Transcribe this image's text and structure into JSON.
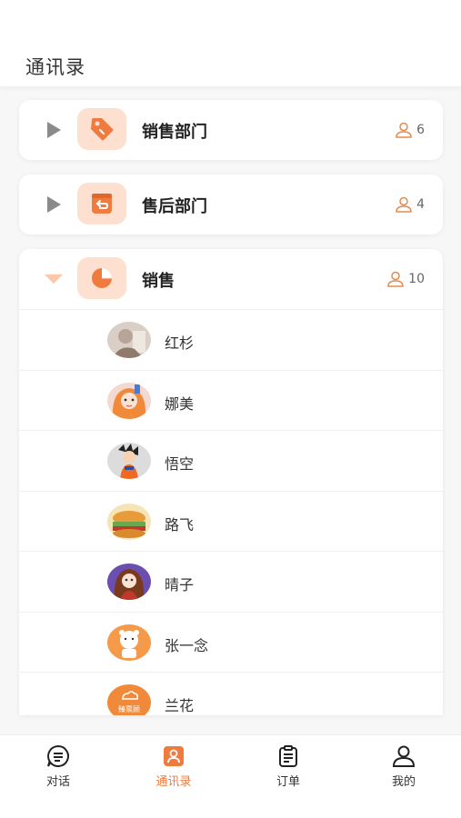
{
  "header": {
    "title": "通讯录"
  },
  "groups": [
    {
      "name": "销售部门",
      "count": "6",
      "expanded": false,
      "icon": "tag-icon"
    },
    {
      "name": "售后部门",
      "count": "4",
      "expanded": false,
      "icon": "return-box-icon"
    },
    {
      "name": "销售",
      "count": "10",
      "expanded": true,
      "icon": "pie-chart-icon",
      "members": [
        {
          "name": "红杉",
          "avatar": "avatar-photo"
        },
        {
          "name": "娜美",
          "avatar": "avatar-anime-orange-hair"
        },
        {
          "name": "悟空",
          "avatar": "avatar-goku"
        },
        {
          "name": "路飞",
          "avatar": "avatar-food"
        },
        {
          "name": "晴子",
          "avatar": "avatar-anime-girl"
        },
        {
          "name": "张一念",
          "avatar": "avatar-cartoon-bear"
        },
        {
          "name": "兰花",
          "avatar": "avatar-logo",
          "avatar_text": "臻票顾"
        }
      ]
    }
  ],
  "tabbar": {
    "items": [
      {
        "label": "对话",
        "icon": "chat-icon",
        "active": false
      },
      {
        "label": "通讯录",
        "icon": "contacts-icon",
        "active": true
      },
      {
        "label": "订单",
        "icon": "order-icon",
        "active": false
      },
      {
        "label": "我的",
        "icon": "profile-icon",
        "active": false
      }
    ]
  },
  "colors": {
    "accent": "#f07b3f",
    "icon_bg": "#fde0cf",
    "arrow_gray": "#8a8a8a"
  }
}
